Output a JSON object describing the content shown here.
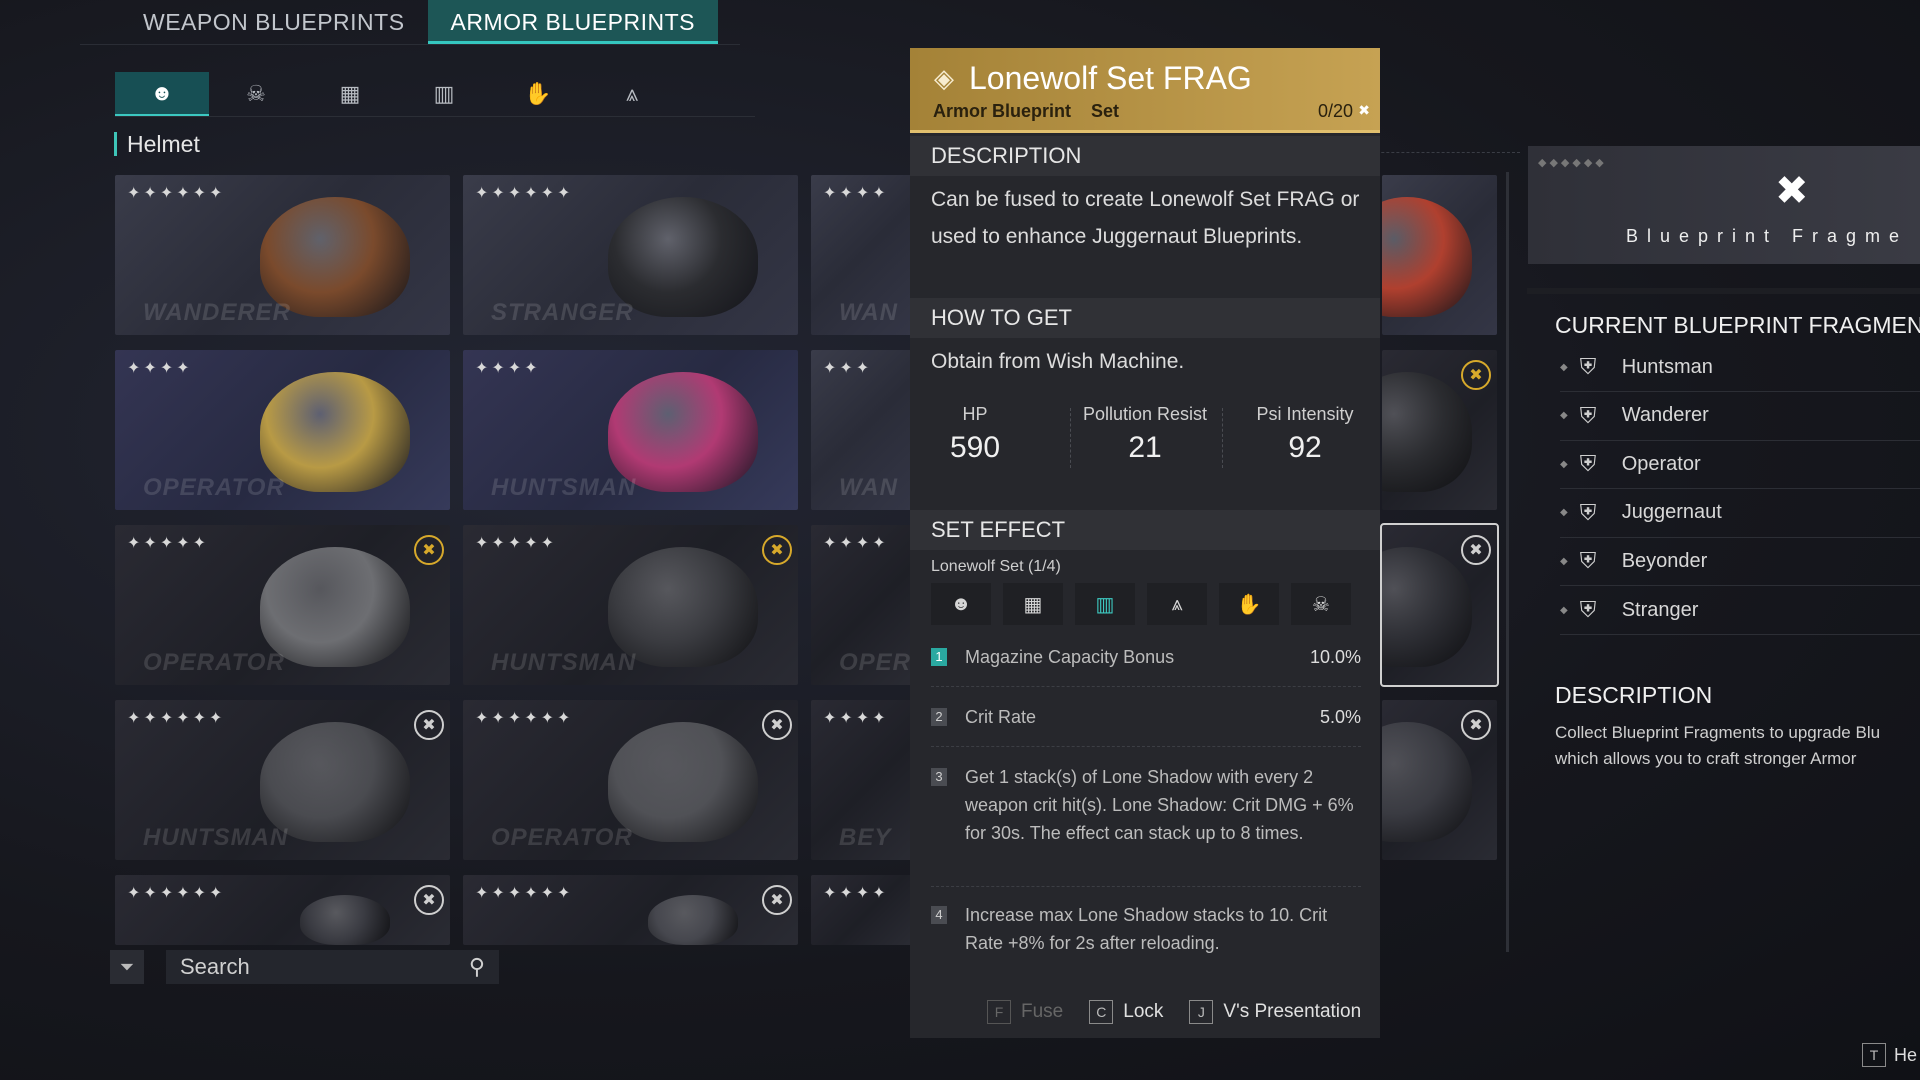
{
  "tabs": [
    "WEAPON BLUEPRINTS",
    "ARMOR BLUEPRINTS"
  ],
  "categories": [
    "helmet-icon",
    "mask-icon",
    "armor-icon",
    "pants-icon",
    "gloves-icon",
    "boots-icon"
  ],
  "category_glyphs": [
    "☻",
    "☠",
    "▦",
    "▥",
    "✋",
    "⩓"
  ],
  "section_label": "Helmet",
  "cards": [
    {
      "stars": "✦✦✦✦✦✦",
      "name": "WANDERER",
      "color": "#7a4a2c",
      "badge": ""
    },
    {
      "stars": "✦✦✦✦✦✦",
      "name": "STRANGER",
      "color": "#2b2c30",
      "badge": ""
    },
    {
      "stars": "✦✦✦✦",
      "name": "WAN",
      "color": "",
      "badge": ""
    },
    {
      "stars": "✦✦✦✦",
      "name": "OPERATOR",
      "color": "#b89a45",
      "badge": ""
    },
    {
      "stars": "✦✦✦✦",
      "name": "HUNTSMAN",
      "color": "#b13a73",
      "badge": ""
    },
    {
      "stars": "✦✦✦",
      "name": "WAN",
      "color": "",
      "badge": ""
    },
    {
      "stars": "✦✦✦✦✦",
      "name": "OPERATOR",
      "color": "#6d6e72",
      "badge": "gold"
    },
    {
      "stars": "✦✦✦✦✦",
      "name": "HUNTSMAN",
      "color": "#3a3b40",
      "badge": "gold"
    },
    {
      "stars": "✦✦✦✦",
      "name": "OPER",
      "color": "",
      "badge": ""
    },
    {
      "stars": "✦✦✦✦✦✦",
      "name": "HUNTSMAN",
      "color": "#4a4b50",
      "badge": "white"
    },
    {
      "stars": "✦✦✦✦✦✦",
      "name": "OPERATOR",
      "color": "#505156",
      "badge": "white"
    },
    {
      "stars": "✦✦✦✦",
      "name": "BEY",
      "color": "",
      "badge": ""
    },
    {
      "stars": "✦✦✦✦✦✦",
      "name": "",
      "color": "#3a3b42",
      "badge": "white"
    },
    {
      "stars": "✦✦✦✦✦✦",
      "name": "",
      "color": "#46474e",
      "badge": "white"
    },
    {
      "stars": "✦✦✦✦",
      "name": "",
      "color": "",
      "badge": ""
    }
  ],
  "right_cards": [
    {
      "color": "#b0402f",
      "badge": ""
    },
    {
      "color": "#2b2c30",
      "badge": "gold"
    },
    {
      "color": "#2e2f35",
      "badge": "white"
    },
    {
      "color": "#3a3b42",
      "badge": "white"
    }
  ],
  "search": {
    "placeholder": "Search"
  },
  "detail": {
    "title": "Lonewolf Set FRAG",
    "type": "Armor Blueprint",
    "set": "Set",
    "count": "0/20",
    "description_header": "DESCRIPTION",
    "description": "Can be fused to create Lonewolf Set FRAG or used to enhance Juggernaut Blueprints.",
    "how_header": "HOW TO GET",
    "how": "Obtain from Wish Machine.",
    "stats": [
      {
        "label": "HP",
        "value": "590"
      },
      {
        "label": "Pollution Resist",
        "value": "21"
      },
      {
        "label": "Psi Intensity",
        "value": "92"
      }
    ],
    "set_header": "SET EFFECT",
    "set_name": "Lonewolf Set (1/4)",
    "set_icons": [
      {
        "icon": "helmet-icon",
        "glyph": "☻",
        "on": false
      },
      {
        "icon": "armor-icon",
        "glyph": "▦",
        "on": false
      },
      {
        "icon": "pants-icon",
        "glyph": "▥",
        "on": true
      },
      {
        "icon": "boots-icon",
        "glyph": "⩓",
        "on": false
      },
      {
        "icon": "gloves-icon",
        "glyph": "✋",
        "on": false
      },
      {
        "icon": "mask-icon",
        "glyph": "☠",
        "on": false
      }
    ],
    "effects": [
      {
        "n": "1",
        "text": "Magazine Capacity Bonus",
        "value": "10.0%"
      },
      {
        "n": "2",
        "text": "Crit Rate",
        "value": "5.0%"
      },
      {
        "n": "3",
        "text": "Get 1 stack(s) of Lone Shadow with every 2 weapon crit hit(s). Lone Shadow: Crit DMG + 6% for 30s. The effect can stack up to 8 times.",
        "value": ""
      },
      {
        "n": "4",
        "text": "Increase max Lone Shadow stacks to 10. Crit Rate +8% for 2s after reloading.",
        "value": ""
      }
    ],
    "actions": [
      {
        "key": "F",
        "label": "Fuse"
      },
      {
        "key": "C",
        "label": "Lock"
      },
      {
        "key": "J",
        "label": "V's Presentation"
      }
    ]
  },
  "right_panel": {
    "fragment_label": "Blueprint Fragme",
    "fragments_title": "CURRENT BLUEPRINT FRAGMEN",
    "fragments": [
      "Huntsman",
      "Wanderer",
      "Operator",
      "Juggernaut",
      "Beyonder",
      "Stranger"
    ],
    "description_title": "DESCRIPTION",
    "description_line1": "Collect Blueprint Fragments to upgrade Blu",
    "description_line2": "which allows you to craft stronger Armor"
  },
  "help": {
    "key": "T",
    "label": "He"
  },
  "colors": {
    "accent": "#35c7c0",
    "gold": "#c6a253"
  }
}
